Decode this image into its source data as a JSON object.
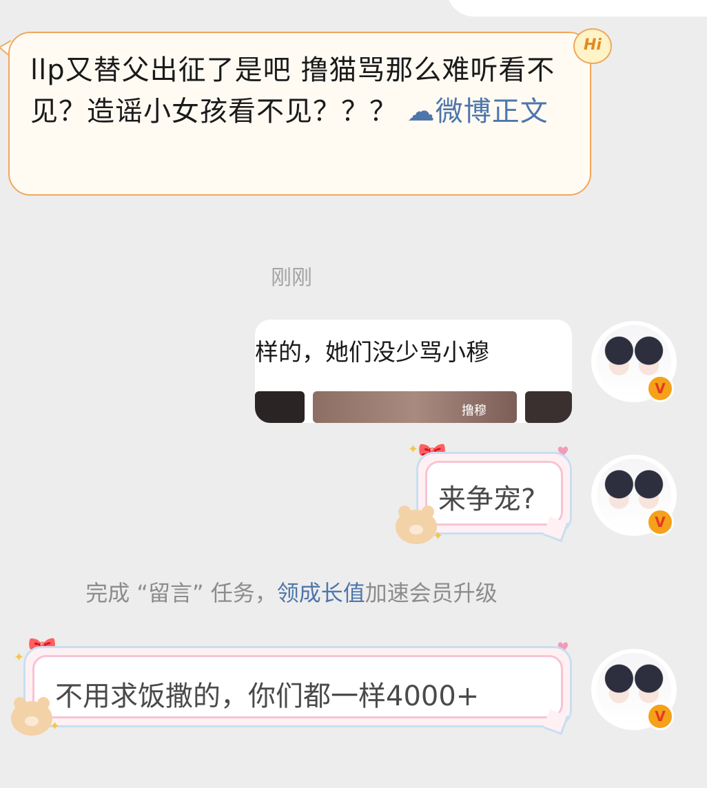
{
  "incoming_message": {
    "text": "llp又替父出征了是吧 撸猫骂那么难听看不见？造谣小女孩看不见？？？",
    "link_icon": "weibo-cloud-icon",
    "link_text": "微博正文",
    "badge": "Hi"
  },
  "timestamp": "刚刚",
  "messages": [
    {
      "type": "image",
      "caption": "样的，她们没少骂小穆",
      "thumb_label": "撸穆"
    },
    {
      "type": "text",
      "text": "来争宠?"
    },
    {
      "type": "text",
      "text": "不用求饭撒的，你们都一样4000+"
    }
  ],
  "system_notice": {
    "prefix": "完成 “留言” 任务，",
    "link": "领成长值",
    "suffix": "加速会员升级"
  },
  "avatar": {
    "badge": "V"
  },
  "colors": {
    "background": "#ededed",
    "incoming_border": "#f0a65a",
    "link": "#4e76aa",
    "deco_pink": "#f6c4d2",
    "deco_blue": "#c7dff0"
  }
}
